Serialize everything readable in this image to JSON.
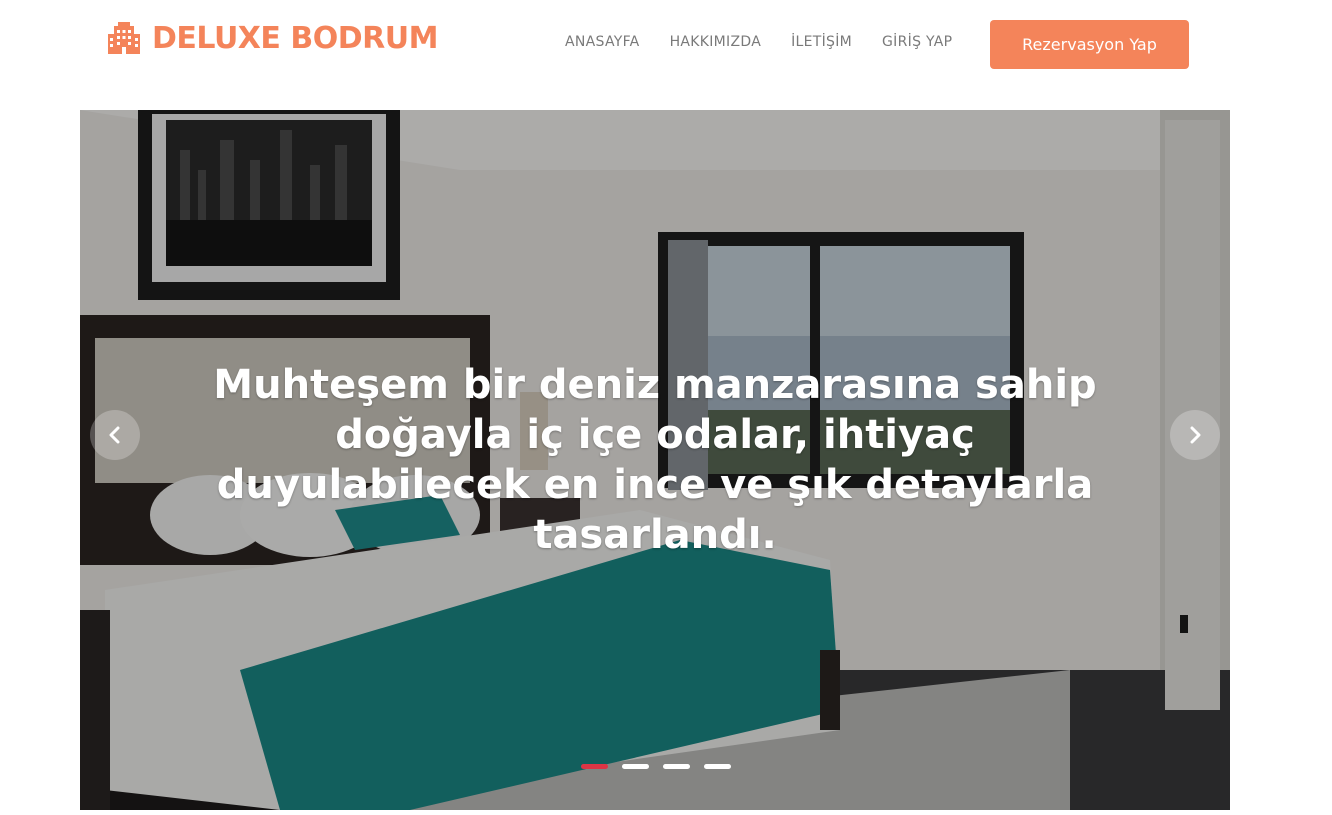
{
  "brand": {
    "name": "DELUXE BODRUM",
    "icon": "building-icon",
    "color": "#f4845a"
  },
  "nav": {
    "links": [
      "ANASAYFA",
      "HAKKIMIZDA",
      "İLETİŞİM",
      "GİRİŞ YAP"
    ],
    "cta_label": "Rezervasyon Yap"
  },
  "hero": {
    "caption": "Muhteşem bir deniz manzarasına sahip doğayla iç içe odalar, ihtiyaç duyulabilecek en ince ve şık detaylarla tasarlandı.",
    "prev_icon": "chevron-left-icon",
    "next_icon": "chevron-right-icon",
    "slide_count": 4,
    "active_slide": 1,
    "indicator_active_color": "#dc3545",
    "indicator_color": "#ffffff"
  }
}
